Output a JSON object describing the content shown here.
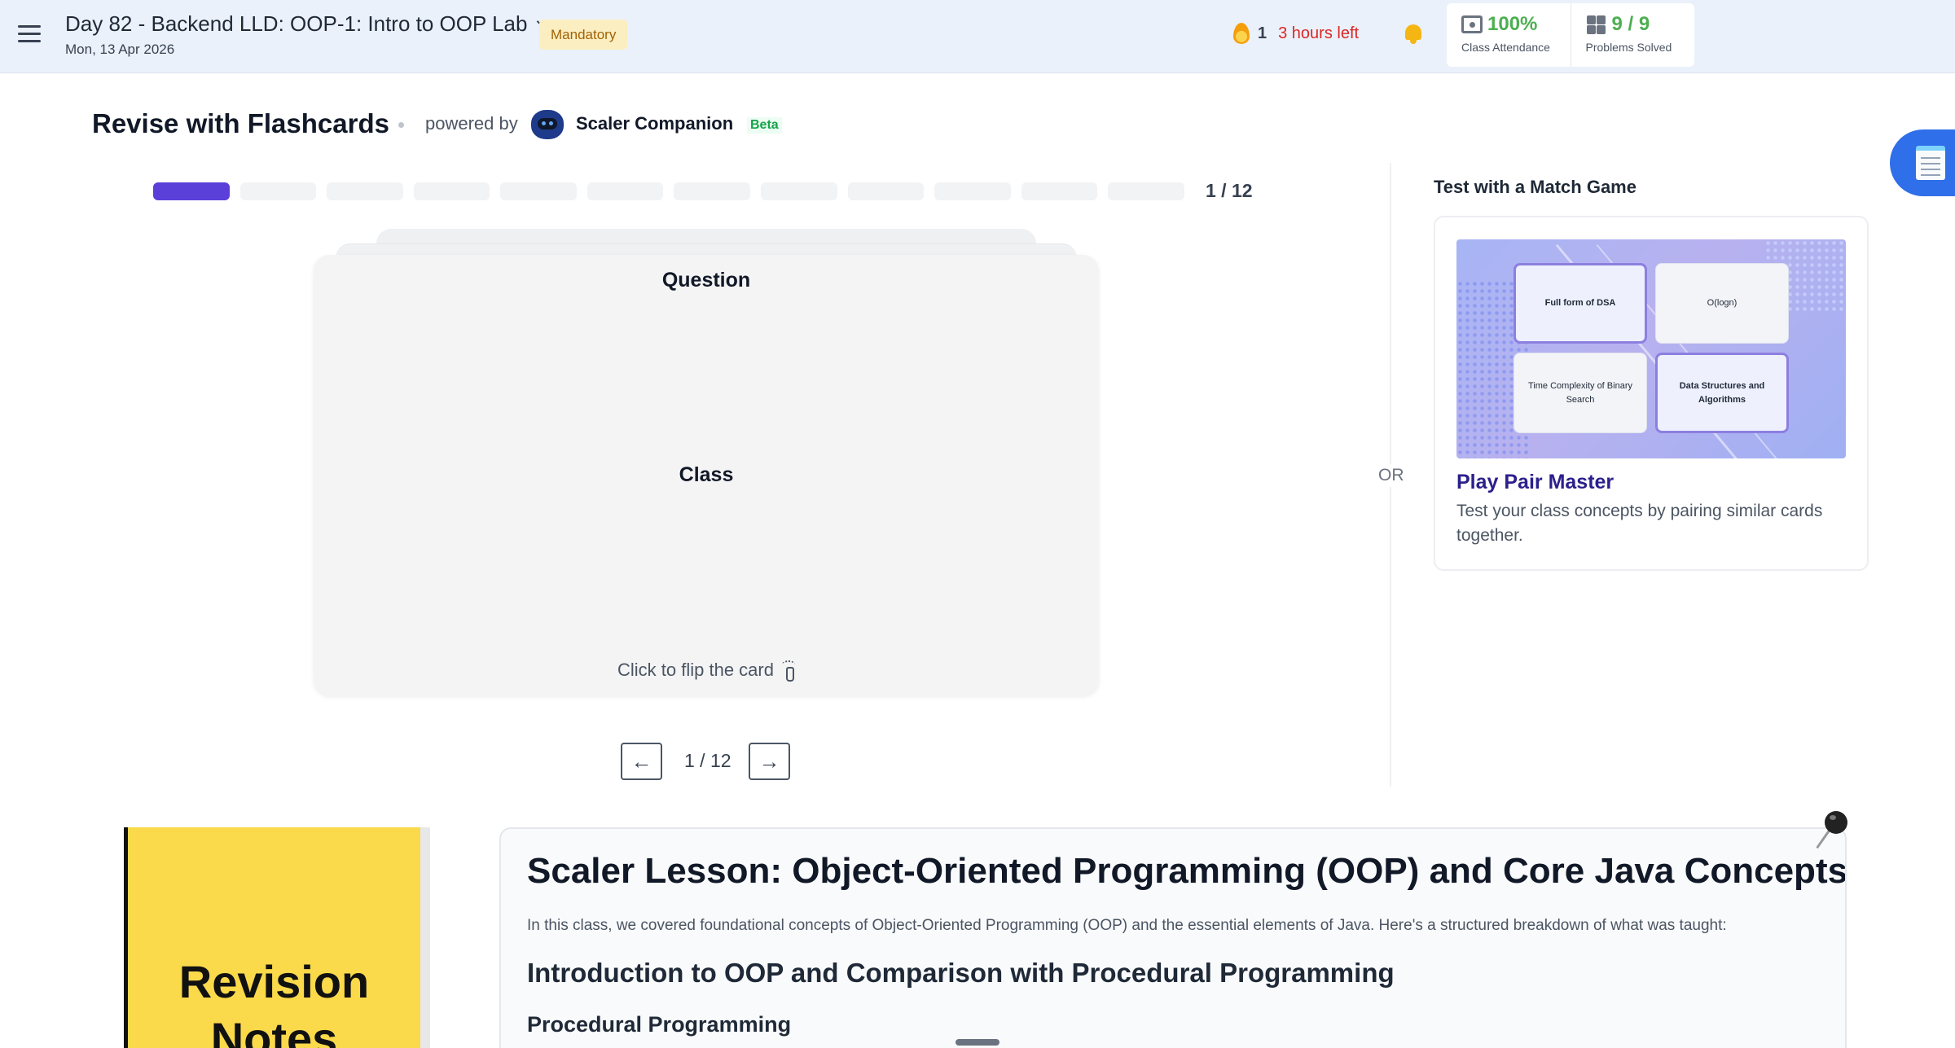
{
  "header": {
    "class_title": "Day 82 - Backend LLD: OOP-1: Intro to OOP Lab",
    "class_date": "Mon, 13 Apr 2026",
    "mandatory_badge": "Mandatory",
    "streak_count": "1",
    "time_left": "3 hours left",
    "attendance": {
      "value": "100%",
      "label": "Class Attendance"
    },
    "problems": {
      "value": "9 / 9",
      "label": "Problems Solved"
    },
    "icons": [
      "menu-icon",
      "chevron-down-icon",
      "flame-icon",
      "bell-icon",
      "attendance-icon",
      "puzzle-icon"
    ]
  },
  "flashcards": {
    "title": "Revise with Flashcards",
    "powered_by": "powered by",
    "companion_name": "Scaler Companion",
    "beta": "Beta",
    "current": 1,
    "total": 12,
    "progress_text": "1 / 12",
    "card": {
      "side_label": "Question",
      "content": "Class",
      "hint": "Click to flip the card"
    },
    "nav": {
      "prev": "←",
      "next": "→",
      "counter": "1 / 12"
    }
  },
  "or_label": "OR",
  "match_game": {
    "heading": "Test with a Match Game",
    "tiles": [
      "Full form of DSA",
      "O(logn)",
      "Time Complexity of Binary Search",
      "Data Structures and Algorithms"
    ],
    "title": "Play Pair Master",
    "description": "Test your class concepts by pairing similar cards together."
  },
  "revision_notes": {
    "sticky_label": "Revision Notes",
    "lesson_title": "Scaler Lesson: Object-Oriented Programming (OOP) and Core Java Concepts",
    "intro": "In this class, we covered foundational concepts of Object-Oriented Programming (OOP) and the essential elements of Java. Here's a structured breakdown of what was taught:",
    "section_heading": "Introduction to OOP and Comparison with Procedural Programming",
    "subsection_heading": "Procedural Programming"
  },
  "colors": {
    "accent": "#5b3fd9",
    "header_bg": "#eaf1fa",
    "success": "#4caf50",
    "danger": "#dc2626",
    "sticky": "#fad94a"
  }
}
